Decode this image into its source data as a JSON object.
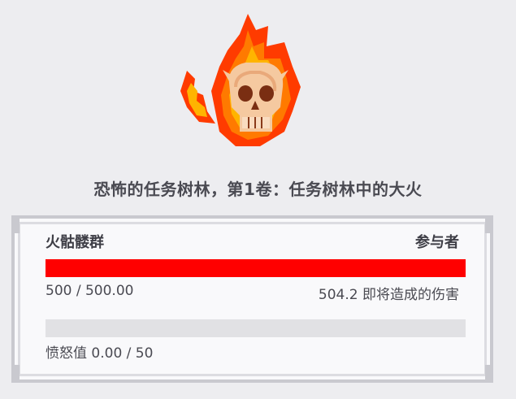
{
  "boss": {
    "image_icon": "flaming-skull-icon",
    "title": "恐怖的任务树林，第1卷：任务树林中的大火"
  },
  "panel": {
    "boss_name": "火骷髅群",
    "participants_label": "参与者",
    "hp": {
      "fraction": 1.0,
      "text": "500 / 500.00",
      "color": "#ff0000"
    },
    "pending_damage_text": "504.2 即将造成的伤害",
    "rage": {
      "fraction": 0.0,
      "text": "愤怒值 0.00 / 50"
    }
  }
}
